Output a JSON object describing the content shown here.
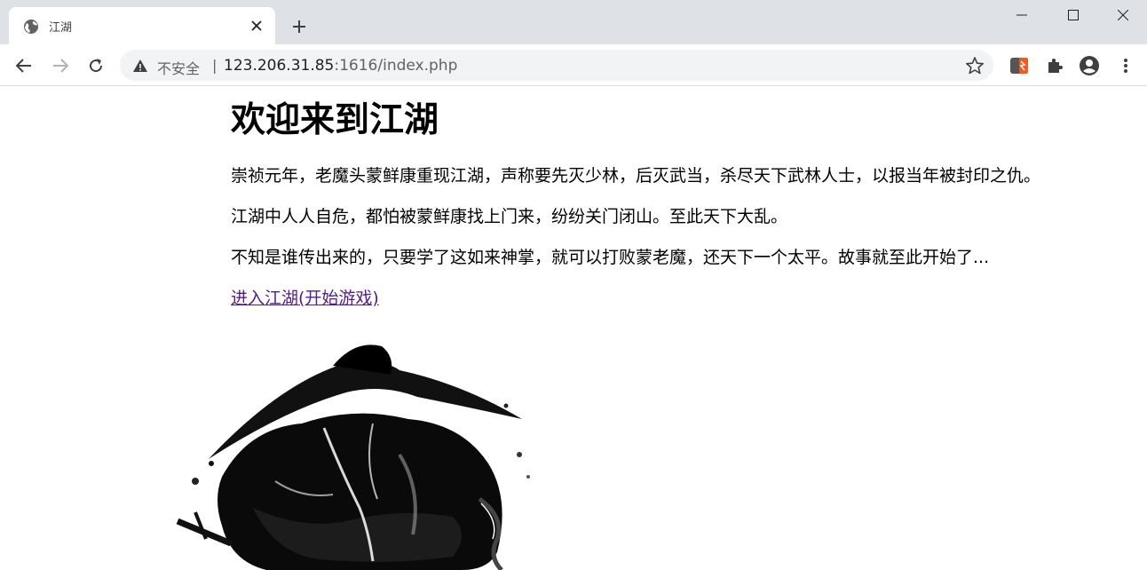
{
  "browser": {
    "tab": {
      "title": "江湖"
    },
    "omnibox": {
      "security_label": "不安全",
      "separator": "|",
      "url_host": "123.206.31.85",
      "url_rest": ":1616/index.php"
    },
    "icons": {
      "favicon": "globe-icon",
      "close": "close-icon",
      "new_tab": "plus-icon",
      "back": "back-arrow-icon",
      "forward": "forward-arrow-icon",
      "reload": "reload-icon",
      "warning": "warning-icon",
      "bookmark": "star-icon",
      "extension": "puzzle-icon",
      "profile": "account-icon",
      "menu": "kebab-menu-icon"
    }
  },
  "page": {
    "heading": "欢迎来到江湖",
    "paragraphs": [
      "崇祯元年，老魔头蒙鲜康重现江湖，声称要先灭少林，后灭武当，杀尽天下武林人士，以报当年被封印之仇。",
      "江湖中人人自危，都怕被蒙鲜康找上门来，纷纷关门闭山。至此天下大乱。",
      "不知是谁传出来的，只要学了这如来神掌，就可以打败蒙老魔，还天下一个太平。故事就至此开始了..."
    ],
    "start_link": "进入江湖(开始游戏)",
    "link_color": "#551a8b"
  }
}
